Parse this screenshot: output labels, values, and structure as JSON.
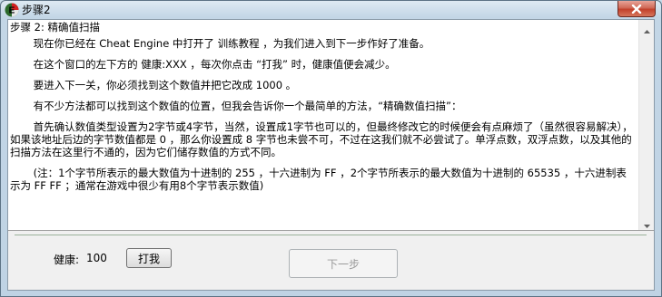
{
  "window": {
    "title": "步骤2",
    "icon": "cheat-engine-logo-icon",
    "close_icon": "close-icon"
  },
  "tutorial": {
    "paragraphs": [
      "步骤 2: 精确值扫描",
      "       现在你已经在 Cheat Engine 中打开了 训练教程 ，为我们进入到下一步作好了准备。",
      "       在这个窗口的左下方的 健康:XXX ，每次你点击 “打我” 时，健康值便会减少。",
      "       要进入下一关，你必须找到这个数值并把它改成 1000 。",
      "       有不少方法都可以找到这个数值的位置，但我会告诉你一个最简单的方法，“精确数值扫描”：",
      "       首先确认数值类型设置为2字节或4字节，当然，设置成1字节也可以的，但最终修改它的时候便会有点麻烦了（虽然很容易解决），如果该地址后边的字节数值都是 0 ，那么你设置成 8 字节也未尝不可，不过在这我们就不必尝试了。单浮点数，双浮点数，以及其他的扫描方法在这里行不通的，因为它们储存数值的方式不同。",
      "",
      "       (注：1个字节所表示的最大数值为十进制的 255 ，十六进制为 FF ，2个字节所表示的最大数值为十进制的 65535 ，十六进制表示为 FF FF ；通常在游戏中很少有用8个字节表示数值)"
    ]
  },
  "status": {
    "health_label": "健康:",
    "health_value": "100"
  },
  "buttons": {
    "hit_label": "打我",
    "next_label": "下一步",
    "next_enabled": false
  },
  "colors": {
    "window_frame": "#c3d6e6",
    "close_button": "#c2402b",
    "separator": "#99b199",
    "disabled_text": "#9a9a9a"
  }
}
